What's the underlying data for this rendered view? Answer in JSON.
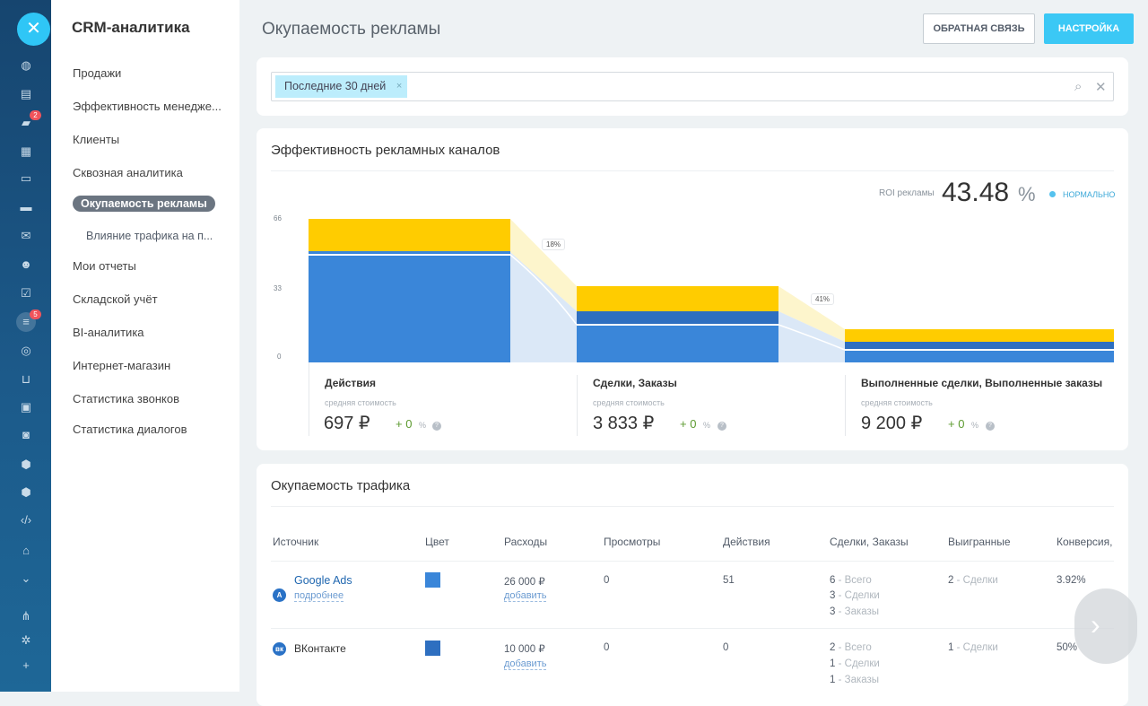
{
  "rail": {
    "badge_messages": "2",
    "badge_funnel": "5"
  },
  "nav": {
    "title": "CRM-аналитика",
    "items": [
      "Продажи",
      "Эффективность менедже...",
      "Клиенты",
      "Сквозная аналитика"
    ],
    "active": "Окупаемость рекламы",
    "sub": "Влияние трафика на п...",
    "items2": [
      "Мои отчеты",
      "Складской учёт",
      "BI-аналитика",
      "Интернет-магазин",
      "Статистика звонков",
      "Статистика диалогов"
    ]
  },
  "header": {
    "title": "Окупаемость рекламы",
    "feedback": "ОБРАТНАЯ СВЯЗЬ",
    "settings": "НАСТРОЙКА"
  },
  "filter": {
    "chip": "Последние 30 дней",
    "chip_close": "×"
  },
  "channels": {
    "title": "Эффективность рекламных каналов",
    "roi_label": "ROI рекламы",
    "roi_value": "43.48",
    "roi_unit": "%",
    "roi_status": "НОРМАЛЬНО",
    "axis": [
      "66",
      "33",
      "0"
    ],
    "transitions": [
      "18%",
      "41%"
    ],
    "stages": [
      {
        "name": "Действия",
        "sub": "средняя стоимость",
        "value": "697 ₽",
        "delta": "+ 0",
        "dpct": "%"
      },
      {
        "name": "Сделки, Заказы",
        "sub": "средняя стоимость",
        "value": "3 833 ₽",
        "delta": "+ 0",
        "dpct": "%"
      },
      {
        "name": "Выполненные сделки, Выполненные заказы",
        "sub": "средняя стоимость",
        "value": "9 200 ₽",
        "delta": "+ 0",
        "dpct": "%"
      }
    ],
    "colors": {
      "yellow": "#ffcc00",
      "blue": "#3a86d9",
      "darkblue": "#2e6fc0",
      "band": "#dbe8f7"
    }
  },
  "traffic": {
    "title": "Окупаемость трафика",
    "headers": [
      "Источник",
      "Цвет",
      "Расходы",
      "Просмотры",
      "Действия",
      "Сделки, Заказы",
      "Выигранные",
      "Конверсия,"
    ],
    "rows": [
      {
        "icon": "google-ads-icon",
        "source": "Google Ads",
        "more": "подробнее",
        "color": "#3a86d9",
        "expense": "26 000 ₽",
        "add": "добавить",
        "views": "0",
        "actions": "51",
        "deals": [
          "6",
          "- Всего",
          "3",
          "- Сделки",
          "3",
          "- Заказы"
        ],
        "won": "2",
        "won_label": "- Сделки",
        "conv": "3.92%"
      },
      {
        "icon": "vk-icon",
        "source": "ВКонтакте",
        "color": "#2e6fc0",
        "expense": "10 000 ₽",
        "add": "добавить",
        "views": "0",
        "actions": "0",
        "deals": [
          "2",
          "- Всего",
          "1",
          "- Сделки",
          "1",
          "- Заказы"
        ],
        "won": "1",
        "won_label": "- Сделки",
        "conv": "50%"
      }
    ]
  }
}
